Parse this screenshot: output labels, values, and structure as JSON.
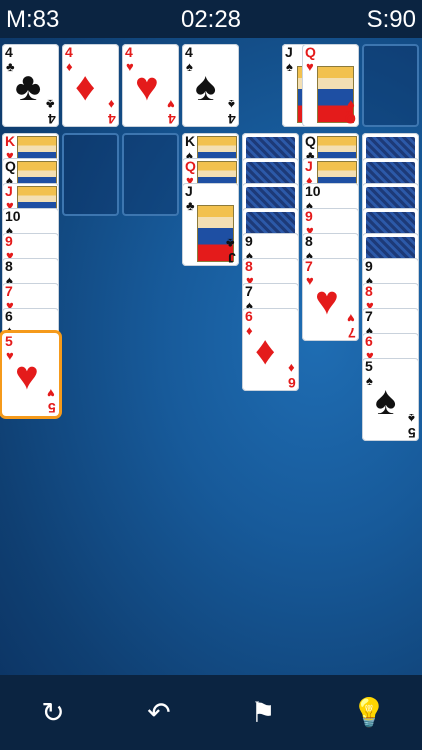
{
  "status": {
    "moves": "M:83",
    "time": "02:28",
    "score": "S:90"
  },
  "foundations": [
    {
      "rank": "4",
      "suit": "♣",
      "color": "black"
    },
    {
      "rank": "4",
      "suit": "♦",
      "color": "red"
    },
    {
      "rank": "4",
      "suit": "♥",
      "color": "red"
    },
    {
      "rank": "4",
      "suit": "♠",
      "color": "black"
    }
  ],
  "free_cells": [
    {
      "rank": "J",
      "suit": "♠",
      "color": "black"
    },
    {
      "rank": "Q",
      "suit": "♥",
      "color": "red"
    }
  ],
  "tableau": [
    {
      "cards": [
        {
          "rank": "K",
          "suit": "♥",
          "color": "red"
        },
        {
          "rank": "Q",
          "suit": "♠",
          "color": "black"
        },
        {
          "rank": "J",
          "suit": "♥",
          "color": "red"
        },
        {
          "rank": "10",
          "suit": "♠",
          "color": "black"
        },
        {
          "rank": "9",
          "suit": "♥",
          "color": "red"
        },
        {
          "rank": "8",
          "suit": "♠",
          "color": "black"
        },
        {
          "rank": "7",
          "suit": "♥",
          "color": "red"
        },
        {
          "rank": "6",
          "suit": "♠",
          "color": "black"
        },
        {
          "rank": "5",
          "suit": "♥",
          "color": "red",
          "selected": true
        }
      ]
    },
    {
      "cards": []
    },
    {
      "cards": []
    },
    {
      "cards": [
        {
          "rank": "K",
          "suit": "♠",
          "color": "black"
        },
        {
          "rank": "Q",
          "suit": "♥",
          "color": "red"
        },
        {
          "rank": "J",
          "suit": "♣",
          "color": "black"
        }
      ]
    },
    {
      "face_down": 4,
      "cards": [
        {
          "rank": "9",
          "suit": "♠",
          "color": "black"
        },
        {
          "rank": "8",
          "suit": "♥",
          "color": "red"
        },
        {
          "rank": "7",
          "suit": "♠",
          "color": "black"
        },
        {
          "rank": "6",
          "suit": "♦",
          "color": "red"
        }
      ]
    },
    {
      "cards": [
        {
          "rank": "Q",
          "suit": "♣",
          "color": "black"
        },
        {
          "rank": "J",
          "suit": "♦",
          "color": "red"
        },
        {
          "rank": "10",
          "suit": "♠",
          "color": "black"
        },
        {
          "rank": "9",
          "suit": "♥",
          "color": "red"
        },
        {
          "rank": "8",
          "suit": "♠",
          "color": "black"
        },
        {
          "rank": "7",
          "suit": "♥",
          "color": "red"
        }
      ]
    },
    {
      "face_down": 5,
      "cards": [
        {
          "rank": "9",
          "suit": "♠",
          "color": "black"
        },
        {
          "rank": "8",
          "suit": "♥",
          "color": "red"
        },
        {
          "rank": "7",
          "suit": "♠",
          "color": "black"
        },
        {
          "rank": "6",
          "suit": "♥",
          "color": "red"
        },
        {
          "rank": "5",
          "suit": "♠",
          "color": "black"
        }
      ]
    }
  ],
  "toolbar": [
    {
      "name": "restart-button",
      "icon": "refresh-icon",
      "glyph": "↻"
    },
    {
      "name": "undo-button",
      "icon": "undo-icon",
      "glyph": "↶"
    },
    {
      "name": "flag-button",
      "icon": "flag-icon",
      "glyph": "⚑"
    },
    {
      "name": "hint-button",
      "icon": "lightbulb-icon",
      "glyph": "💡"
    }
  ],
  "colors": {
    "selection": "#f59a1b",
    "red_suit": "#e41b1b",
    "bar": "#0b2441"
  }
}
